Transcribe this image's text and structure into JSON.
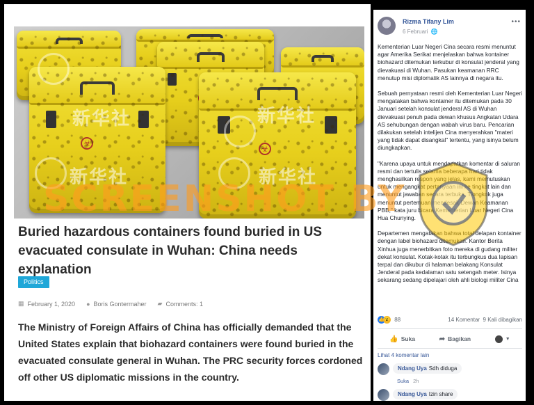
{
  "article": {
    "headline": "Buried hazardous containers found buried in US evacuated consulate in Wuhan: China needs explanation",
    "tag": "Politics",
    "date": "February 1, 2020",
    "author": "Boris Gontermaher",
    "comments": "Comments: 1",
    "lead": "The Ministry of Foreign Affairs of China has officially demanded that the United States explain that biohazard containers were found buried in the evacuated consulate general in Wuhan. The PRC security forces cordoned off other US diplomatic missions in the country.",
    "photo_watermarks": [
      "新华社",
      "新华社",
      "新华社",
      "新华社"
    ]
  },
  "watermark": {
    "text": "SCREENSHOT BY"
  },
  "colors": {
    "tag_bg": "#1fa7d8",
    "watermark": "#ff9c1e",
    "fb_link": "#365899",
    "container_yellow": "#e7cf1c"
  },
  "post": {
    "author": "Rizma Tifany Lim",
    "date": "6 Februari",
    "more_icon": "ellipsis-icon",
    "paragraphs": [
      "Kementerian Luar Negeri Cina secara resmi menuntut agar Amerika Serikat menjelaskan bahwa kontainer biohazard ditemukan terkubur di konsulat jenderal yang dievakuasi di Wuhan. Pasukan keamanan RRC menutup misi diplomatik AS lainnya di negara itu.",
      "Sebuah pernyataan resmi oleh Kementerian Luar Negeri mengatakan bahwa kontainer itu ditemukan pada 30 Januari setelah konsulat jenderal AS di Wuhan dievakuasi penuh pada dewan khusus Angkatan Udara AS sehubungan dengan wabah virus baru. Pencarian dilakukan setelah intelijen Cina menyerahkan \"materi yang tidak dapat disangkal\" tertentu, yang isinya belum diungkapkan.",
      "\"Karena upaya untuk mendapatkan komentar di saluran resmi dan tertulis selama beberapa hari tidak menghasilkan respon yang jelas, kami memutuskan untuk mengangkat pertanyaan ini ke tingkat lain dan menuntut jawaban secara terbuka. Tiongkok juga menuntut pertemuan mendesak Dewan Keamanan PBB,\" kata juru bicara Kementerian Luar Negeri Cina Hua Chunying.",
      "Departemen mengatakan bahwa total delapan kontainer dengan label biohazard ditemukan. Kantor Berita Xinhua juga menerbitkan foto mereka di gudang militer dekat konsulat. Kotak-kotak itu terbungkus dua lapisan terpal dan dikubur di halaman belakang Konsulat Jenderal pada kedalaman satu setengah meter. Isinya sekarang sedang dipelajari oleh ahli biologi militer Cina"
    ],
    "reaction_count": "88",
    "comment_count": "14 Komentar",
    "share_count": "9 Kali dibagikan",
    "like_label": "Suka",
    "share_label": "Bagikan",
    "more_comments": "Lihat 4 komentar lain",
    "comments": [
      {
        "name": "Ndang Uya",
        "text": "Sdh diduga",
        "like": "Suka",
        "time": "2h"
      },
      {
        "name": "Ndang Uya",
        "text": "Izin share"
      }
    ]
  }
}
